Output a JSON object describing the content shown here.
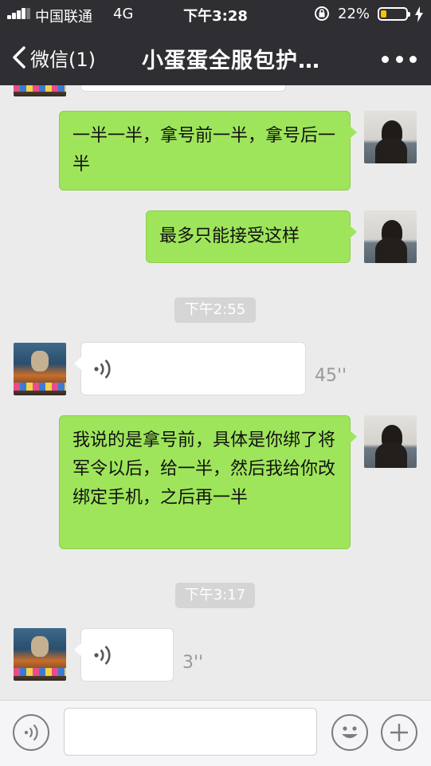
{
  "status_bar": {
    "carrier": "中国联通",
    "network": "4G",
    "time": "下午3:28",
    "battery_percent_text": "22%",
    "battery_level": 0.22,
    "battery_color": "#f7c500"
  },
  "nav": {
    "back_label": "微信(1)",
    "title": "小蛋蛋全服包护…",
    "more_icon": "more-dots-icon"
  },
  "messages": [
    {
      "from": "me",
      "text": "一半一半，拿号前一半，拿号后一半"
    },
    {
      "from": "me",
      "text": "最多只能接受这样"
    },
    {
      "type": "time",
      "text": "下午2:55"
    },
    {
      "from": "other",
      "type": "voice",
      "duration": "45''"
    },
    {
      "from": "me",
      "text": "我说的是拿号前，具体是你绑了将军令以后，给一半，然后我给你改绑定手机，之后再一半"
    },
    {
      "type": "time",
      "text": "下午3:17"
    },
    {
      "from": "other",
      "type": "voice",
      "duration": "3''"
    }
  ],
  "input_bar": {
    "voice_icon": "voice-toggle-icon",
    "emoji_icon": "emoji-icon",
    "plus_icon": "plus-icon",
    "placeholder": ""
  },
  "colors": {
    "header_bg": "#2e2e33",
    "chat_bg": "#ebebeb",
    "my_bubble": "#9fe55b",
    "other_bubble": "#ffffff"
  }
}
